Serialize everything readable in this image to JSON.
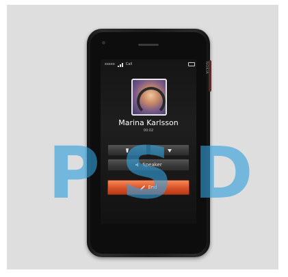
{
  "watermark": {
    "letters": [
      "P",
      "S",
      "D"
    ]
  },
  "status_bar": {
    "operator": "xxxxx",
    "network": "Call"
  },
  "call": {
    "caller_name": "Marina Karlsson",
    "timer": "00:02"
  },
  "buttons": {
    "speaker_label": "Speaker",
    "end_label": "End"
  },
  "device": {
    "side_label": "NOKIA"
  },
  "colors": {
    "end_button": "#d95228",
    "watermark": "#34a0dc",
    "background": "#dedede"
  },
  "icons": [
    "mute-icon",
    "hold-icon",
    "speaker-icon",
    "phone-end-icon",
    "signal-icon",
    "battery-icon"
  ]
}
